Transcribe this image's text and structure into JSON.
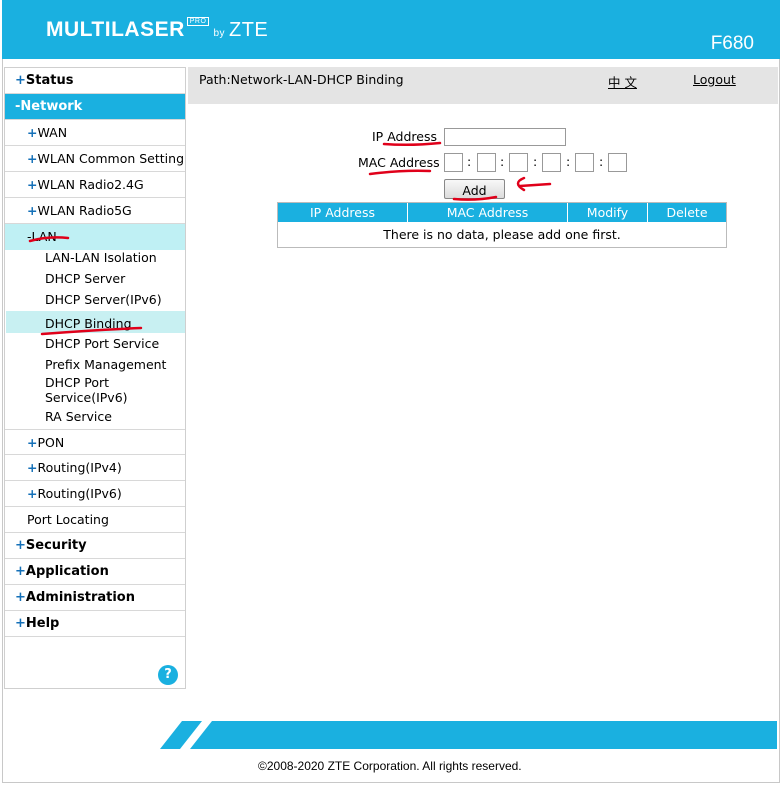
{
  "header": {
    "brand": "MULTILASER",
    "brand_tm": "PRO",
    "by": "by",
    "vendor": "ZTE",
    "model": "F680"
  },
  "sidebar": {
    "items": [
      {
        "label": "Status",
        "prefix": "+"
      },
      {
        "label": "Network",
        "prefix": "-"
      },
      {
        "label": "WAN",
        "prefix": "+"
      },
      {
        "label": "WLAN Common Setting",
        "prefix": "+"
      },
      {
        "label": "WLAN Radio2.4G",
        "prefix": "+"
      },
      {
        "label": "WLAN Radio5G",
        "prefix": "+"
      },
      {
        "label": "LAN",
        "prefix": "-"
      },
      {
        "label": "PON",
        "prefix": "+"
      },
      {
        "label": "Routing(IPv4)",
        "prefix": "+"
      },
      {
        "label": "Routing(IPv6)",
        "prefix": "+"
      },
      {
        "label": "Port Locating",
        "prefix": ""
      },
      {
        "label": "Security",
        "prefix": "+"
      },
      {
        "label": "Application",
        "prefix": "+"
      },
      {
        "label": "Administration",
        "prefix": "+"
      },
      {
        "label": "Help",
        "prefix": "+"
      }
    ],
    "lan_children": [
      "LAN-LAN Isolation",
      "DHCP Server",
      "DHCP Server(IPv6)",
      "DHCP Binding",
      "DHCP Port Service",
      "Prefix Management",
      "DHCP Port",
      "Service(IPv6)",
      "RA Service"
    ],
    "help_icon": "?"
  },
  "topbar": {
    "path": "Path:Network-LAN-DHCP Binding",
    "language": "中 文",
    "logout": "Logout"
  },
  "form": {
    "ip_label": "IP Address",
    "ip_value": "",
    "mac_label": "MAC Address",
    "mac_separator": ":",
    "add_label": "Add"
  },
  "table": {
    "headers": [
      "IP Address",
      "MAC Address",
      "Modify",
      "Delete"
    ],
    "empty_message": "There is no data, please add one first."
  },
  "footer": {
    "copyright": "©2008-2020 ZTE Corporation. All rights reserved."
  },
  "colors": {
    "accent": "#1ab0e0",
    "annotation": "#e0001a"
  }
}
